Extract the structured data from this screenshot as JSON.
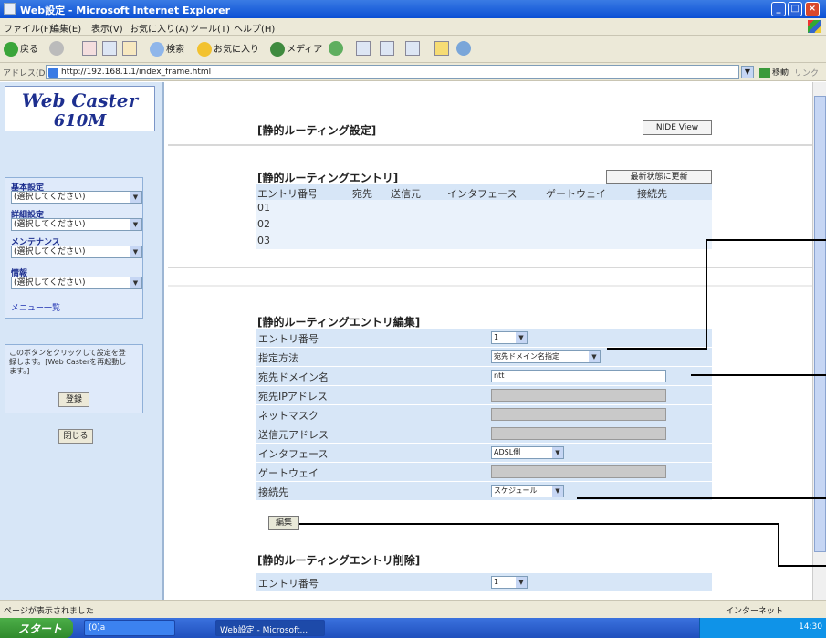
{
  "window": {
    "title": "Web設定 - Microsoft Internet Explorer",
    "minimize": "_",
    "maximize": "□",
    "close": "×"
  },
  "menubar": {
    "items": [
      "ファイル(F)",
      "編集(E)",
      "表示(V)",
      "お気に入り(A)",
      "ツール(T)",
      "ヘルプ(H)"
    ]
  },
  "toolbar": {
    "back": "戻る",
    "search": "検索",
    "favorites": "お気に入り",
    "media": "メディア"
  },
  "address": {
    "label": "アドレス(D)",
    "url": "http://192.168.1.1/index_frame.html",
    "go": "移動",
    "links": "リンク"
  },
  "sidebar": {
    "logo_line1": "Web Caster",
    "logo_line2": "610M",
    "sections": [
      {
        "label": "基本設定",
        "select": "(選択してください)"
      },
      {
        "label": "詳細設定",
        "select": "(選択してください)"
      },
      {
        "label": "メンテナンス",
        "select": "(選択してください)"
      },
      {
        "label": "情報",
        "select": "(選択してください)"
      }
    ],
    "menu_link": "メニュー一覧",
    "help_text": "このボタンをクリックして設定を登録します。[Web Casterを再起動します。]",
    "register_button": "登録",
    "close_button": "閉じる"
  },
  "main": {
    "page_title": "[静的ルーティング設定]",
    "ide_view_button": "NIDE View",
    "entries_heading": "[静的ルーティングエントリ]",
    "refresh_button": "最新状態に更新",
    "entries_columns": [
      "エントリ番号",
      "宛先",
      "送信元",
      "インタフェース",
      "ゲートウェイ",
      "接続先"
    ],
    "entries_rows": [
      "01",
      "02",
      "03"
    ],
    "edit_heading": "[静的ルーティングエントリ編集]",
    "edit_rows": [
      {
        "label": "エントリ番号",
        "value": "1",
        "kind": "select-small"
      },
      {
        "label": "指定方法",
        "value": "宛先ドメイン名指定",
        "kind": "select"
      },
      {
        "label": "宛先ドメイン名",
        "value": "ntt",
        "kind": "input"
      },
      {
        "label": "宛先IPアドレス",
        "value": "",
        "kind": "disabled"
      },
      {
        "label": "ネットマスク",
        "value": "",
        "kind": "disabled"
      },
      {
        "label": "送信元アドレス",
        "value": "",
        "kind": "disabled"
      },
      {
        "label": "インタフェース",
        "value": "ADSL側",
        "kind": "select"
      },
      {
        "label": "ゲートウェイ",
        "value": "",
        "kind": "disabled"
      },
      {
        "label": "接続先",
        "value": "スケジュール",
        "kind": "select"
      }
    ],
    "edit_button": "編集",
    "delete_heading": "[静的ルーティングエントリ削除]",
    "delete_rows": [
      {
        "label": "エントリ番号",
        "value": "1"
      }
    ]
  },
  "statusbar": {
    "text": "ページが表示されました",
    "zone": "インターネット"
  },
  "taskbar": {
    "start": "スタート",
    "items": [
      "(0)a",
      "Web設定 - Microsoft..."
    ],
    "clock": "14:30"
  }
}
